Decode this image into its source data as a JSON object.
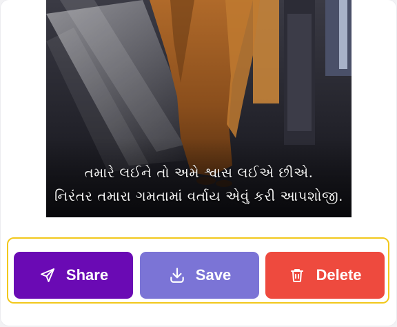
{
  "image": {
    "caption_line1": "તમારે લઈને તો અમે શ્વાસ લઈએ છીએ.",
    "caption_line2": "નિરંતર તમારા ગમતામાં વર્તાય એવું કરી આપશોજી."
  },
  "actions": {
    "share_label": "Share",
    "save_label": "Save",
    "delete_label": "Delete",
    "share_icon": "send-icon",
    "save_icon": "download-icon",
    "delete_icon": "trash-icon"
  },
  "colors": {
    "share": "#6a0ab4",
    "save": "#7b74d6",
    "delete": "#ee4a3e",
    "highlight_border": "#f2c81c"
  }
}
